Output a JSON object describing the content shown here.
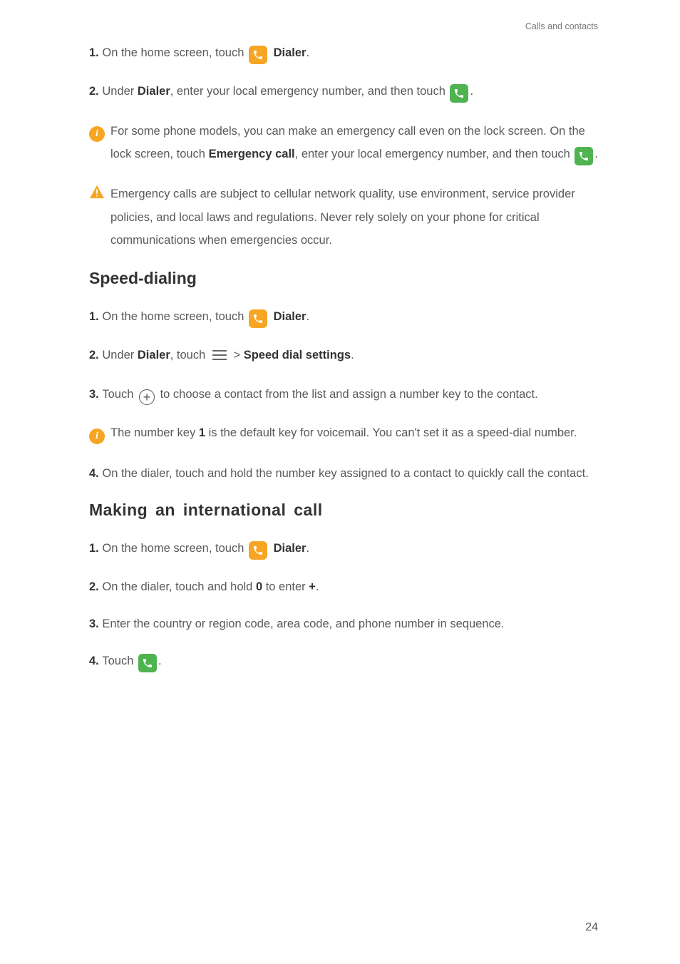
{
  "header": {
    "breadcrumb": "Calls and contacts"
  },
  "emergency_call": {
    "step1_prefix": "1. ",
    "step1_text_a": "On the home screen, touch ",
    "step1_label_dialer": "Dialer",
    "step1_period": ".",
    "step2_prefix": "2. ",
    "step2_text_a": "Under ",
    "step2_dialer": "Dialer",
    "step2_text_b": ", enter your local emergency number, and then touch ",
    "step2_period": ".",
    "note1_a": "For some phone models, you can make an emergency call even on the lock screen. On the lock screen, touch ",
    "note1_emergency": "Emergency call",
    "note1_b": ", enter your local emergency number, and then touch ",
    "note1_period": ".",
    "warn_text": "Emergency calls are subject to cellular network quality, use environment, service provider policies, and local laws and regulations. Never rely solely on your phone for critical communications when emergencies occur."
  },
  "speed_dialing": {
    "heading": "Speed-dialing",
    "step1_prefix": "1. ",
    "step1_text_a": "On the home screen, touch ",
    "step1_label_dialer": "Dialer",
    "step1_period": ".",
    "step2_prefix": "2. ",
    "step2_text_a": "Under ",
    "step2_dialer": "Dialer",
    "step2_text_b": ", touch ",
    "step2_gt": " > ",
    "step2_settings": "Speed dial settings",
    "step2_period": ".",
    "step3_prefix": "3. ",
    "step3_text_a": "Touch ",
    "step3_text_b": " to choose a contact from the list and assign a number key to the contact.",
    "note_a": "The number key ",
    "note_key": "1",
    "note_b": " is the default key for voicemail. You can't set it as a speed-dial number.",
    "step4_prefix": "4. ",
    "step4_text": "On the dialer, touch and hold the number key assigned to a contact to quickly call the contact."
  },
  "international": {
    "heading": "Making an international call",
    "step1_prefix": "1. ",
    "step1_text_a": "On the home screen, touch ",
    "step1_label_dialer": "Dialer",
    "step1_period": ".",
    "step2_prefix": "2. ",
    "step2_text_a": "On the dialer, touch and hold ",
    "step2_zero": "0",
    "step2_text_b": " to enter ",
    "step2_plus": "+",
    "step2_period": ".",
    "step3_prefix": "3. ",
    "step3_text": "Enter the country or region code, area code, and phone number in sequence.",
    "step4_prefix": "4. ",
    "step4_text_a": "Touch ",
    "step4_period": "."
  },
  "page_number": "24"
}
